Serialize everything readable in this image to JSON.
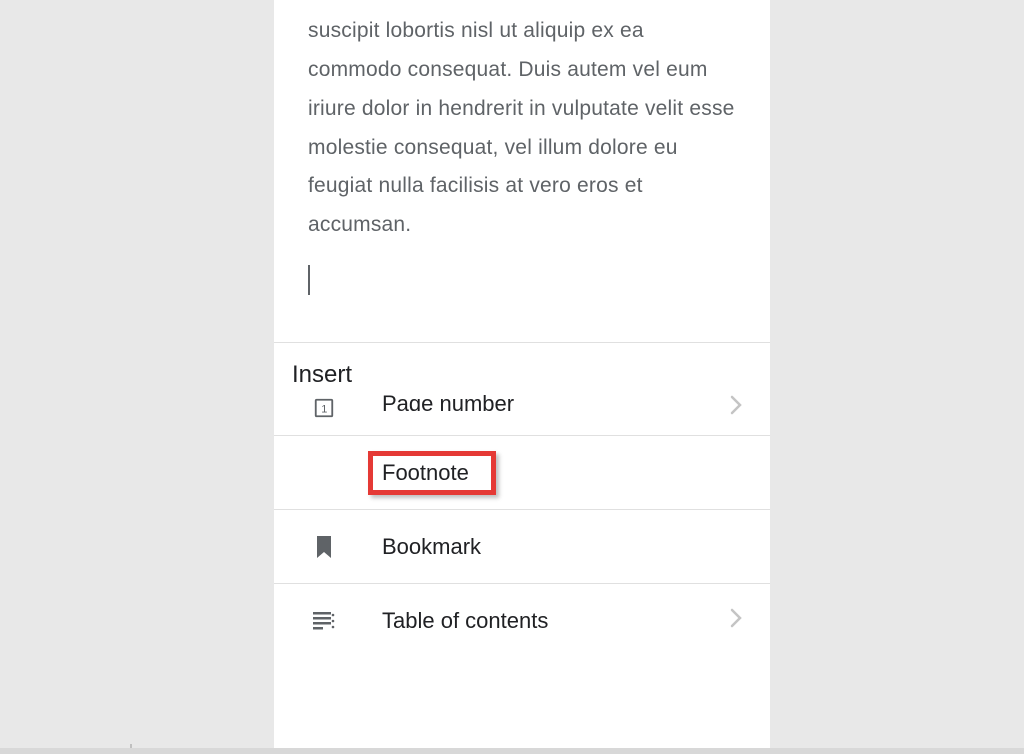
{
  "document": {
    "body_text": "suscipit lobortis nisl ut aliquip ex ea commodo consequat. Duis autem vel eum iriure dolor in hendrerit in vulputate velit esse molestie consequat, vel illum dolore eu feugiat nulla facilisis at vero eros et accumsan."
  },
  "insert_panel": {
    "title": "Insert",
    "items": [
      {
        "label": "Page number",
        "has_chevron": true
      },
      {
        "label": "Footnote",
        "has_chevron": false,
        "highlighted": true
      },
      {
        "label": "Bookmark",
        "has_chevron": false
      },
      {
        "label": "Table of contents",
        "has_chevron": true
      }
    ]
  }
}
